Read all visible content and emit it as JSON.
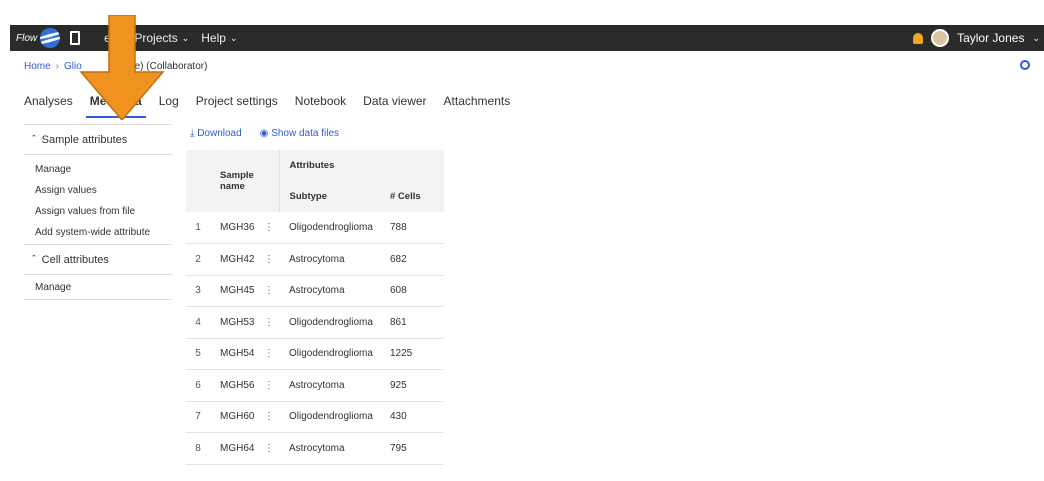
{
  "topbar": {
    "brand_small": "Flow",
    "nav": [
      {
        "label": "e",
        "icon": "device-icon"
      },
      {
        "label": "Projects",
        "icon": "chevron-down-icon"
      },
      {
        "label": "Help",
        "icon": "chevron-down-icon"
      }
    ],
    "user": "Taylor Jones"
  },
  "breadcrumb": {
    "home": "Home",
    "current_left": "Glio",
    "current_right": "ple) (Collaborator)"
  },
  "tabs": [
    "Analyses",
    "Metadata",
    "Log",
    "Project settings",
    "Notebook",
    "Data viewer",
    "Attachments"
  ],
  "active_tab": "Metadata",
  "sidebar": {
    "sample_header": "Sample attributes",
    "sample_items": [
      "Manage",
      "Assign values",
      "Assign values from file",
      "Add system-wide attribute"
    ],
    "cell_header": "Cell attributes",
    "cell_items": [
      "Manage"
    ]
  },
  "actions": {
    "download": "Download",
    "show_files": "Show data files"
  },
  "table": {
    "sample_name_header": "Sample name",
    "attributes_header": "Attributes",
    "subtype_header": "Subtype",
    "cells_header": "# Cells",
    "rows": [
      {
        "idx": "1",
        "name": "MGH36",
        "subtype": "Oligodendroglioma",
        "cells": "788"
      },
      {
        "idx": "2",
        "name": "MGH42",
        "subtype": "Astrocytoma",
        "cells": "682"
      },
      {
        "idx": "3",
        "name": "MGH45",
        "subtype": "Astrocytoma",
        "cells": "608"
      },
      {
        "idx": "4",
        "name": "MGH53",
        "subtype": "Oligodendroglioma",
        "cells": "861"
      },
      {
        "idx": "5",
        "name": "MGH54",
        "subtype": "Oligodendroglioma",
        "cells": "1225"
      },
      {
        "idx": "6",
        "name": "MGH56",
        "subtype": "Astrocytoma",
        "cells": "925"
      },
      {
        "idx": "7",
        "name": "MGH60",
        "subtype": "Oligodendroglioma",
        "cells": "430"
      },
      {
        "idx": "8",
        "name": "MGH64",
        "subtype": "Astrocytoma",
        "cells": "795"
      }
    ]
  },
  "colors": {
    "accent": "#2d5bd8",
    "arrow": "#f0921e",
    "topbar": "#2b2b2b"
  }
}
